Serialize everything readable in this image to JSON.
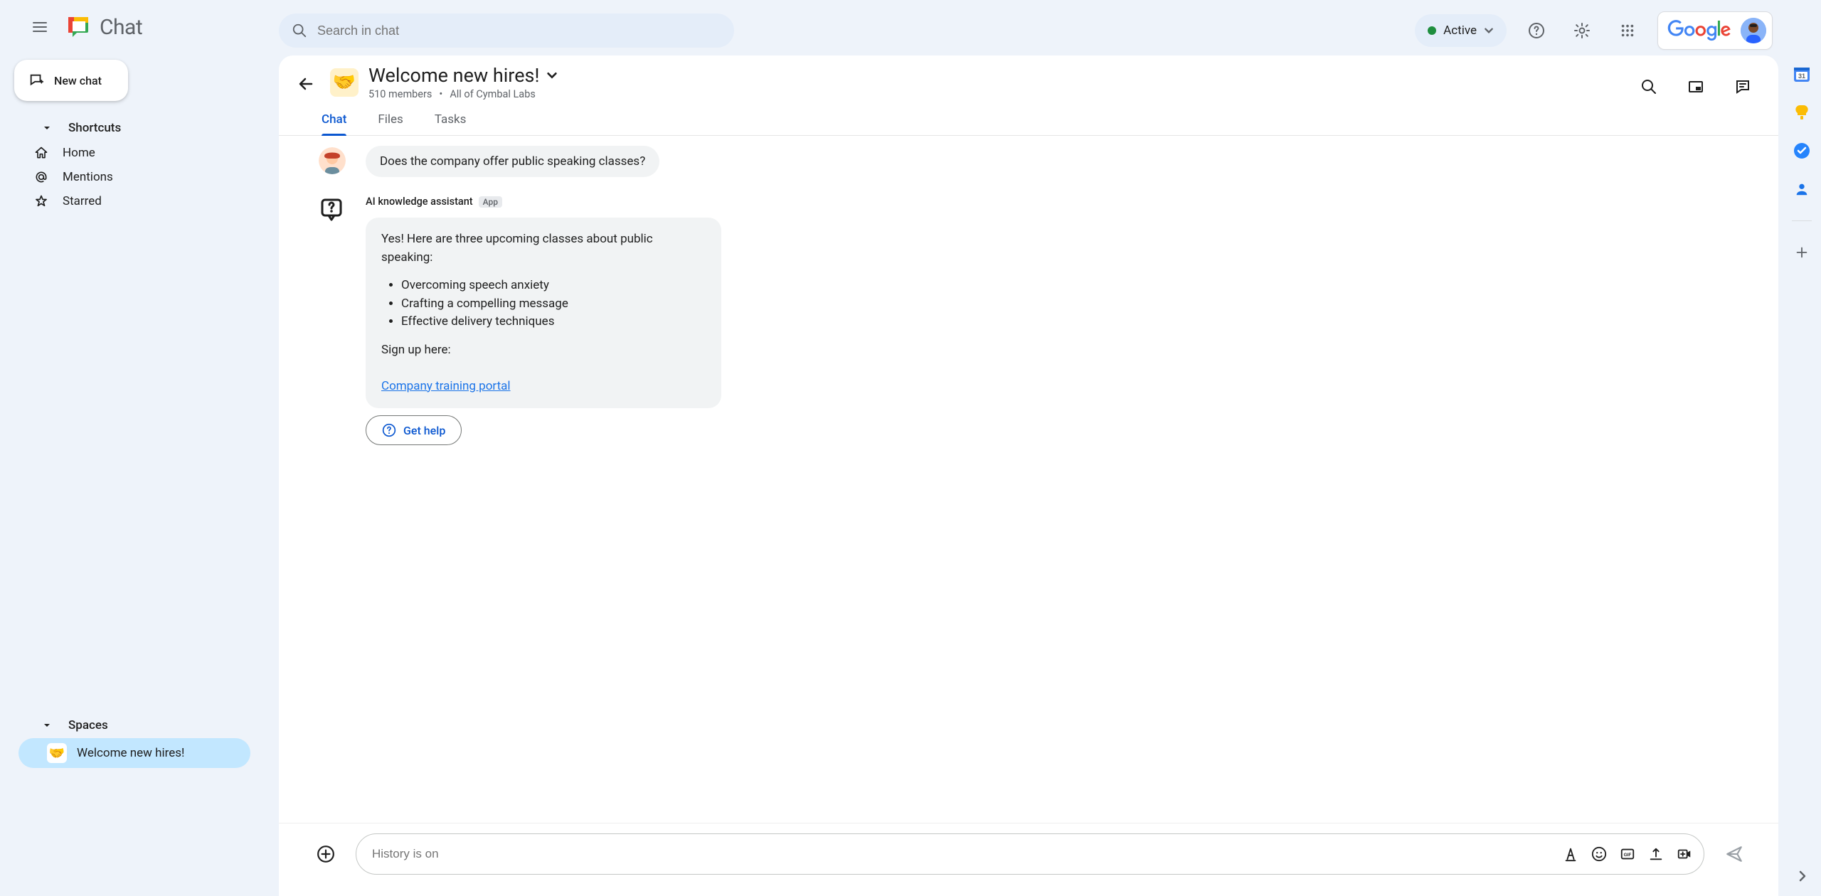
{
  "app": {
    "name": "Chat"
  },
  "search": {
    "placeholder": "Search in chat"
  },
  "status": {
    "label": "Active"
  },
  "new_chat_label": "New chat",
  "sidebar": {
    "shortcuts_label": "Shortcuts",
    "items": [
      {
        "label": "Home"
      },
      {
        "label": "Mentions"
      },
      {
        "label": "Starred"
      }
    ],
    "spaces_label": "Spaces",
    "space_items": [
      {
        "label": "Welcome new hires!",
        "emoji": "🤝"
      }
    ]
  },
  "space": {
    "emoji": "🤝",
    "title": "Welcome new hires!",
    "members": "510 members",
    "dot": "•",
    "audience": "All of Cymbal Labs",
    "tabs": [
      "Chat",
      "Files",
      "Tasks"
    ]
  },
  "messages": {
    "user_question": "Does the company offer public speaking classes?",
    "assistant": {
      "name": "AI knowledge assistant",
      "badge": "App",
      "intro": "Yes! Here are three upcoming classes about public speaking:",
      "bullets": [
        "Overcoming speech anxiety",
        "Crafting a compelling message",
        "Effective delivery techniques"
      ],
      "signup": "Sign up here:",
      "link_label": "Company training portal",
      "get_help": "Get help"
    }
  },
  "composer": {
    "placeholder": "History is on"
  },
  "google_label": "Google"
}
